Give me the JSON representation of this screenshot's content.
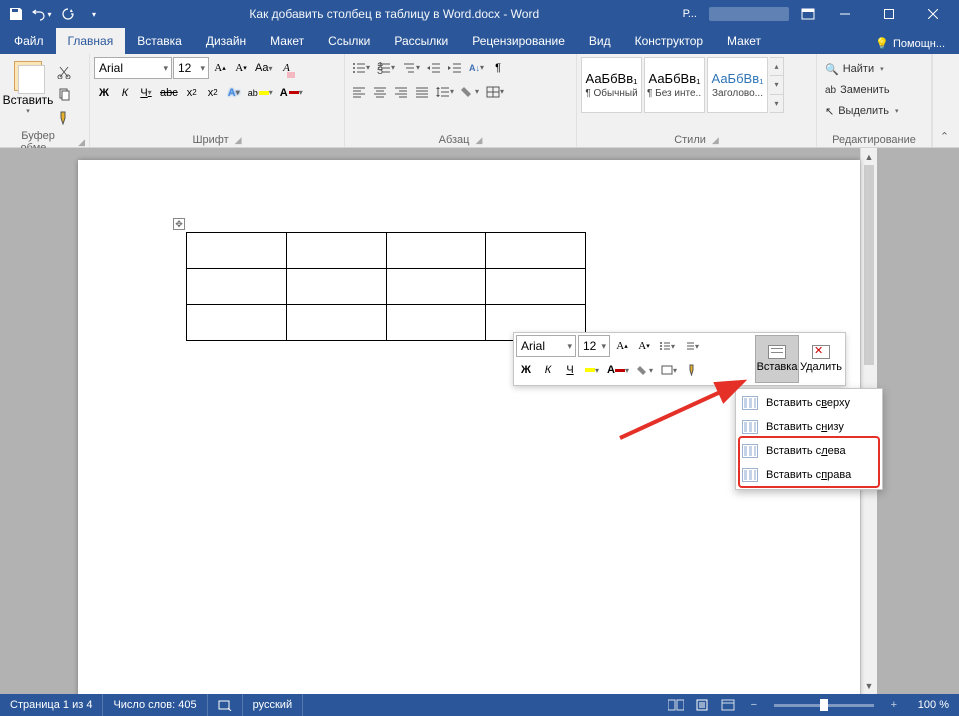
{
  "title": "Как добавить столбец в таблицу в Word.docx  -  Word",
  "tabs": {
    "file": "Файл",
    "home": "Главная",
    "insert": "Вставка",
    "design": "Дизайн",
    "layout": "Макет",
    "refs": "Ссылки",
    "mail": "Рассылки",
    "review": "Рецензирование",
    "view": "Вид",
    "ctor": "Конструктор",
    "layout2": "Макет"
  },
  "help": "Помощн...",
  "ribbon": {
    "clipboard": {
      "paste": "Вставить",
      "label": "Буфер обме..."
    },
    "font": {
      "name": "Arial",
      "size": "12",
      "label": "Шрифт"
    },
    "para": {
      "label": "Абзац"
    },
    "styles": {
      "label": "Стили",
      "sample": "АаБбВв₁",
      "s1": "¶ Обычный",
      "s2": "¶ Без инте...",
      "s3": "Заголово..."
    },
    "editing": {
      "label": "Редактирование",
      "find": "Найти",
      "replace": "Заменить",
      "select": "Выделить"
    }
  },
  "mini": {
    "font": "Arial",
    "size": "12",
    "insert": "Вставка",
    "delete": "Удалить"
  },
  "menu": {
    "i1": "Вставить сверху",
    "i2": "Вставить снизу",
    "i3": "Вставить слева",
    "i4": "Вставить справа",
    "u1": "в",
    "u2": "н",
    "u3": "л",
    "u4": "п"
  },
  "status": {
    "page": "Страница 1 из 4",
    "words": "Число слов: 405",
    "lang": "русский",
    "zoom": "100 %"
  },
  "account": "Р..."
}
